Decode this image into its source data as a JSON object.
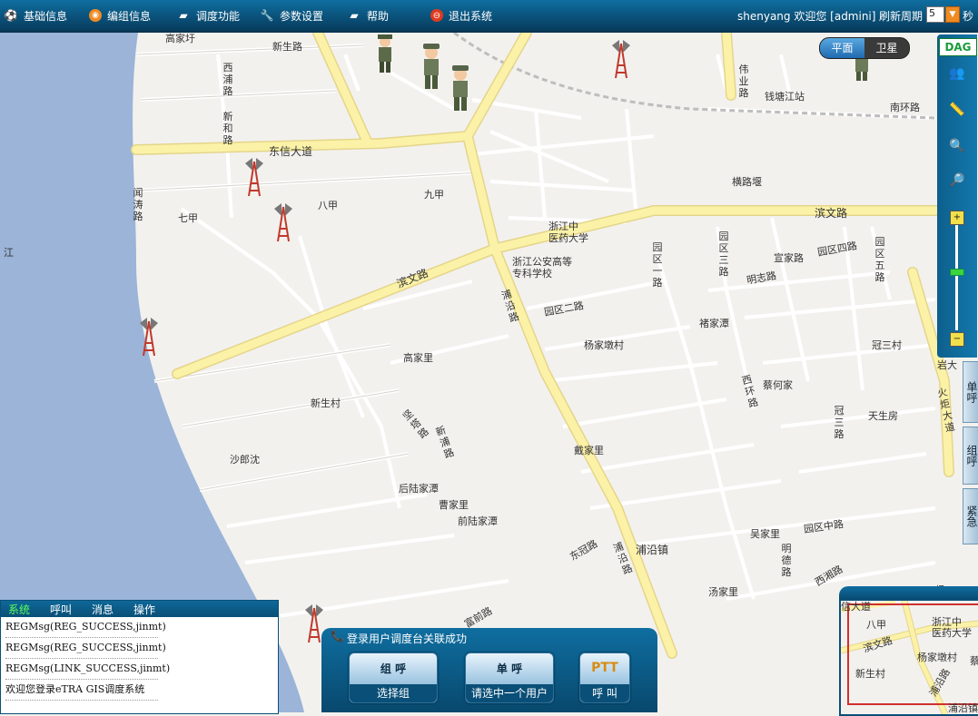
{
  "menu": [
    {
      "label": "基础信息",
      "icon": "soccer-ball-icon"
    },
    {
      "label": "编组信息",
      "icon": "rss-icon"
    },
    {
      "label": "调度功能",
      "icon": "monitor-icon"
    },
    {
      "label": "参数设置",
      "icon": "wrench-icon"
    },
    {
      "label": "帮助",
      "icon": "monitor-icon"
    },
    {
      "label": "退出系统",
      "icon": "exit-icon"
    }
  ],
  "header": {
    "welcome": "shenyang 欢迎您 [admini]",
    "refresh_label": "刷新周期",
    "refresh_value": "5",
    "refresh_unit": "秒"
  },
  "map_toggle": {
    "plain": "平面",
    "satellite": "卫星"
  },
  "logo": "DAG",
  "map_labels": {
    "gaojiayu": "高家圩",
    "xinsheng_road": "新生路",
    "dongxin": "东信大道",
    "bajia": "八甲",
    "jiujia": "九甲",
    "qijia": "七甲",
    "binwen": "滨文路",
    "binwen2": "滨文路",
    "hengluyan": "横路堰",
    "zhejiang_univ": "浙江中\n医药大学",
    "police_school": "浙江公安高等\n专科学校",
    "yuanqu2": "园区二路",
    "yangjiadun": "杨家墩村",
    "chujiatan": "褚家潭",
    "guansan": "冠三村",
    "gaojiali": "高家里",
    "xinsheng_cun": "新生村",
    "shalangshen": "沙郎沈",
    "houlujiatan": "后陆家潭",
    "caojiali": "曹家里",
    "qianlujiatan": "前陆家潭",
    "daijiali": "戴家里",
    "caihejia": "蔡何家",
    "tianshengfang": "天生房",
    "xuanjia_road": "宣家路",
    "yuanqu4": "园区四路",
    "mingzhi": "明志路",
    "wujiali": "吴家里",
    "yuanqu_zhong": "园区中路",
    "puyan_zhen": "浦沿镇",
    "tangjiali": "汤家里",
    "xixiang": "西湘路",
    "donguan": "东冠路",
    "fuqian": "富前路",
    "qiantang_station": "钱塘江站",
    "nanhuan": "南环路",
    "jiang": "江",
    "yanda": "岩大",
    "bigehu": "杨"
  },
  "vertical_labels": {
    "xipu": "西浦路",
    "xinhe": "新和路",
    "wentao": "闻涛路",
    "weiye": "伟业路",
    "puyan_road": "浦沿路",
    "puyan_road2": "浦沿路",
    "yuanqu1": "园区一路",
    "yuanqu3": "园区三路",
    "yuanqu5": "园区五路",
    "xihuan": "西环路",
    "guansan_road": "冠三路",
    "mingde": "明德路",
    "jianta": "坚塔路",
    "xinpu": "新浦路",
    "huoju": "火炬大道"
  },
  "side_tabs": {
    "single": "单呼",
    "group": "组呼",
    "urgent": "紧急"
  },
  "log_tabs": [
    "系统",
    "呼叫",
    "消息",
    "操作"
  ],
  "log_lines": [
    "REGMsg(REG_SUCCESS,jinmt)",
    "REGMsg(REG_SUCCESS,jinmt)",
    "REGMsg(LINK_SUCCESS,jinmt)",
    "欢迎您登录eTRA GIS调度系统"
  ],
  "call_panel": {
    "status": "登录用户调度台关联成功",
    "group_title": "组 呼",
    "group_sub": "选择组",
    "single_title": "单 呼",
    "single_sub": "请选中一个用户",
    "ptt_title": "PTT",
    "ptt_sub": "呼 叫"
  },
  "overview": {
    "l1": "八甲",
    "l2": "浙江中\n医药大学",
    "l3": "滨文路",
    "l4": "杨家墩村",
    "l5": "新生村",
    "l6": "浦沿路",
    "l7": "浦沿镇",
    "l8": "信大道",
    "l9": "蔡"
  },
  "colors": {
    "primary": "#0a4f77",
    "road": "#fbf2a8",
    "road_edge": "#e4d58a",
    "water": "#9bb4d8",
    "land": "#f3f1ee"
  }
}
